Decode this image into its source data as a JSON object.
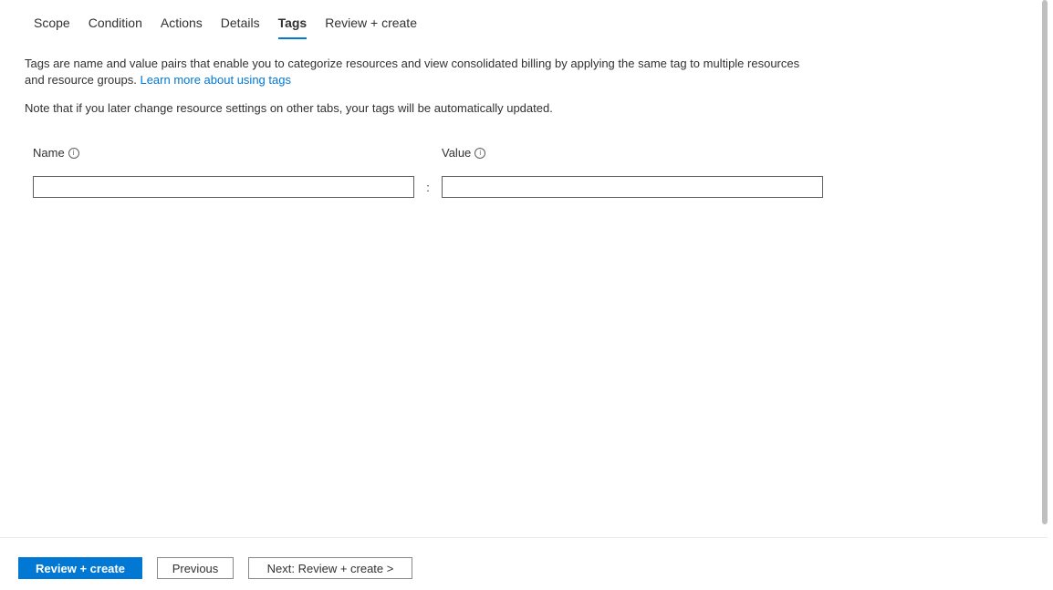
{
  "tabs": {
    "scope": "Scope",
    "condition": "Condition",
    "actions": "Actions",
    "details": "Details",
    "tags": "Tags",
    "review_create": "Review + create"
  },
  "description": {
    "text_before_link": "Tags are name and value pairs that enable you to categorize resources and view consolidated billing by applying the same tag to multiple resources and resource groups. ",
    "link_text": "Learn more about using tags"
  },
  "note": "Note that if you later change resource settings on other tabs, your tags will be automatically updated.",
  "form": {
    "name_label": "Name",
    "value_label": "Value",
    "colon": ":",
    "name_value": "",
    "value_value": ""
  },
  "footer": {
    "review_create": "Review + create",
    "previous": "Previous",
    "next": "Next: Review + create >"
  }
}
